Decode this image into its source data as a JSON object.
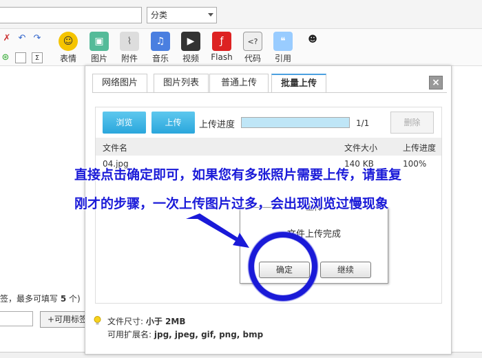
{
  "header": {
    "category_placeholder": "分类"
  },
  "toolbar": {
    "buttons": [
      {
        "label": "表情",
        "icon": "smiley-icon"
      },
      {
        "label": "图片",
        "icon": "picture-icon"
      },
      {
        "label": "附件",
        "icon": "paperclip-icon"
      },
      {
        "label": "音乐",
        "icon": "music-icon"
      },
      {
        "label": "视频",
        "icon": "video-icon"
      },
      {
        "label": "Flash",
        "icon": "flash-icon"
      },
      {
        "label": "代码",
        "icon": "code-icon"
      },
      {
        "label": "引用",
        "icon": "quote-icon"
      }
    ]
  },
  "background": {
    "tag_hint_prefix": "签，最多可填写",
    "tag_hint_count": "5",
    "tag_hint_suffix": "个)",
    "add_tag_label": "+可用标签"
  },
  "dialog": {
    "tabs": [
      "网络图片",
      "图片列表",
      "普通上传",
      "批量上传"
    ],
    "active_tab": 3,
    "close_label": "×",
    "browse_label": "浏览",
    "upload_label": "上传",
    "progress_label": "上传进度",
    "progress_value": 1.0,
    "progress_count": "1/1",
    "delete_label": "删除",
    "columns": [
      "文件名",
      "文件大小",
      "上传进度"
    ],
    "rows": [
      {
        "name": "04.jpg",
        "size": "140 KB",
        "progress": "100%"
      }
    ],
    "file_size_label": "文件尺寸:",
    "file_size_value": "小于  2MB",
    "extensions_label": "可用扩展名:",
    "extensions_value": "jpg, jpeg, gif, png, bmp"
  },
  "message_box": {
    "title": "上传",
    "text": "文件上传完成",
    "ok_label": "确定",
    "continue_label": "继续"
  },
  "annotation": {
    "line1": "直接点击确定即可，如果您有多张照片需要上传，请重复",
    "line2": "刚才的步骤，一次上传图片过多，会出现浏览过慢现象",
    "color": "#1a1ad8"
  }
}
